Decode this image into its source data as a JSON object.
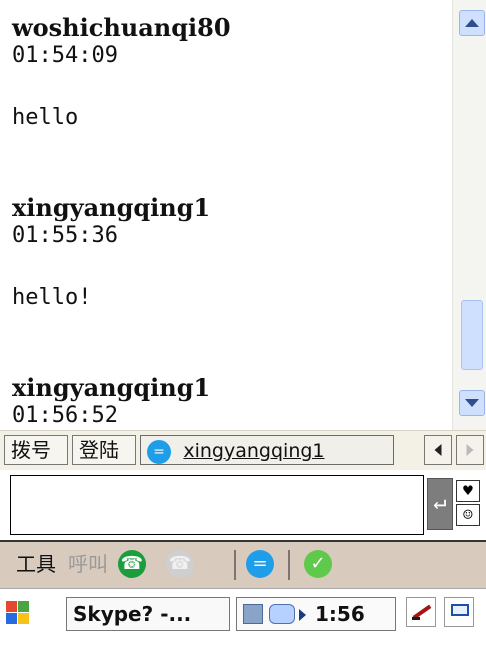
{
  "chat": {
    "messages": [
      {
        "sender": "woshichuanqi80",
        "time": "01:54:09",
        "text": "hello"
      },
      {
        "sender": "xingyangqing1",
        "time": "01:55:36",
        "text": "hello!"
      },
      {
        "sender": "xingyangqing1",
        "time": "01:56:52",
        "text": ""
      }
    ]
  },
  "tabs": {
    "dial": "拨号",
    "login": "登陆",
    "conversation": "xingyangqing1"
  },
  "toolbar": {
    "tools": "工具",
    "call": "呼叫",
    "answer_icon": "green-phone-icon",
    "hangup_icon": "hangup-icon",
    "chat_icon": "chat-bubble-icon",
    "skype_icon": "skype-icon"
  },
  "taskbar": {
    "task_label": "Skype? -...",
    "clock": "1:56"
  },
  "colors": {
    "toolbar_bg": "#d8cabd",
    "scrollbar_blue": "#cfe0ff",
    "answer_green": "#1a9d3c",
    "chat_blue": "#1e9ee8"
  }
}
